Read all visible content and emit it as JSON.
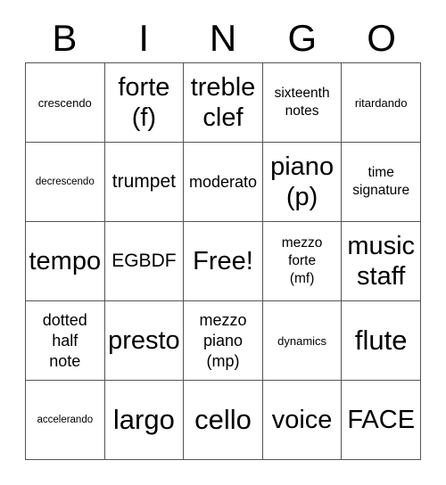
{
  "header": {
    "letters": [
      "B",
      "I",
      "N",
      "G",
      "O"
    ]
  },
  "grid": {
    "rows": 5,
    "columns": 5,
    "border_color": "#555555",
    "background_color": "#ffffff",
    "text_color": "#000000",
    "cells": [
      {
        "text": "crescendo",
        "size": "s",
        "row": 1,
        "col": 1
      },
      {
        "text": "forte\n(f)",
        "size": "xxl",
        "row": 1,
        "col": 2
      },
      {
        "text": "treble\nclef",
        "size": "xxl",
        "row": 1,
        "col": 3
      },
      {
        "text": "sixteenth\nnotes",
        "size": "m",
        "row": 1,
        "col": 4
      },
      {
        "text": "ritardando",
        "size": "s",
        "row": 1,
        "col": 5
      },
      {
        "text": "decrescendo",
        "size": "xs",
        "row": 2,
        "col": 1
      },
      {
        "text": "trumpet",
        "size": "l",
        "row": 2,
        "col": 2
      },
      {
        "text": "moderato",
        "size": "ml",
        "row": 2,
        "col": 3
      },
      {
        "text": "piano\n(p)",
        "size": "xxl",
        "row": 2,
        "col": 4
      },
      {
        "text": "time\nsignature",
        "size": "m",
        "row": 2,
        "col": 5
      },
      {
        "text": "tempo",
        "size": "xxl",
        "row": 3,
        "col": 1
      },
      {
        "text": "EGBDF",
        "size": "l",
        "row": 3,
        "col": 2
      },
      {
        "text": "Free!",
        "size": "xxl",
        "row": 3,
        "col": 3
      },
      {
        "text": "mezzo\nforte\n(mf)",
        "size": "m",
        "row": 3,
        "col": 4
      },
      {
        "text": "music\nstaff",
        "size": "xxl",
        "row": 3,
        "col": 5
      },
      {
        "text": "dotted\nhalf\nnote",
        "size": "ml",
        "row": 4,
        "col": 1
      },
      {
        "text": "presto",
        "size": "xxl",
        "row": 4,
        "col": 2
      },
      {
        "text": "mezzo\npiano\n(mp)",
        "size": "ml",
        "row": 4,
        "col": 3
      },
      {
        "text": "dynamics",
        "size": "s",
        "row": 4,
        "col": 4
      },
      {
        "text": "flute",
        "size": "xxxl",
        "row": 4,
        "col": 5
      },
      {
        "text": "accelerando",
        "size": "xs",
        "row": 5,
        "col": 1
      },
      {
        "text": "largo",
        "size": "xxxl",
        "row": 5,
        "col": 2
      },
      {
        "text": "cello",
        "size": "xxxl",
        "row": 5,
        "col": 3
      },
      {
        "text": "voice",
        "size": "xxl",
        "row": 5,
        "col": 4
      },
      {
        "text": "FACE",
        "size": "xxl",
        "row": 5,
        "col": 5
      }
    ]
  }
}
